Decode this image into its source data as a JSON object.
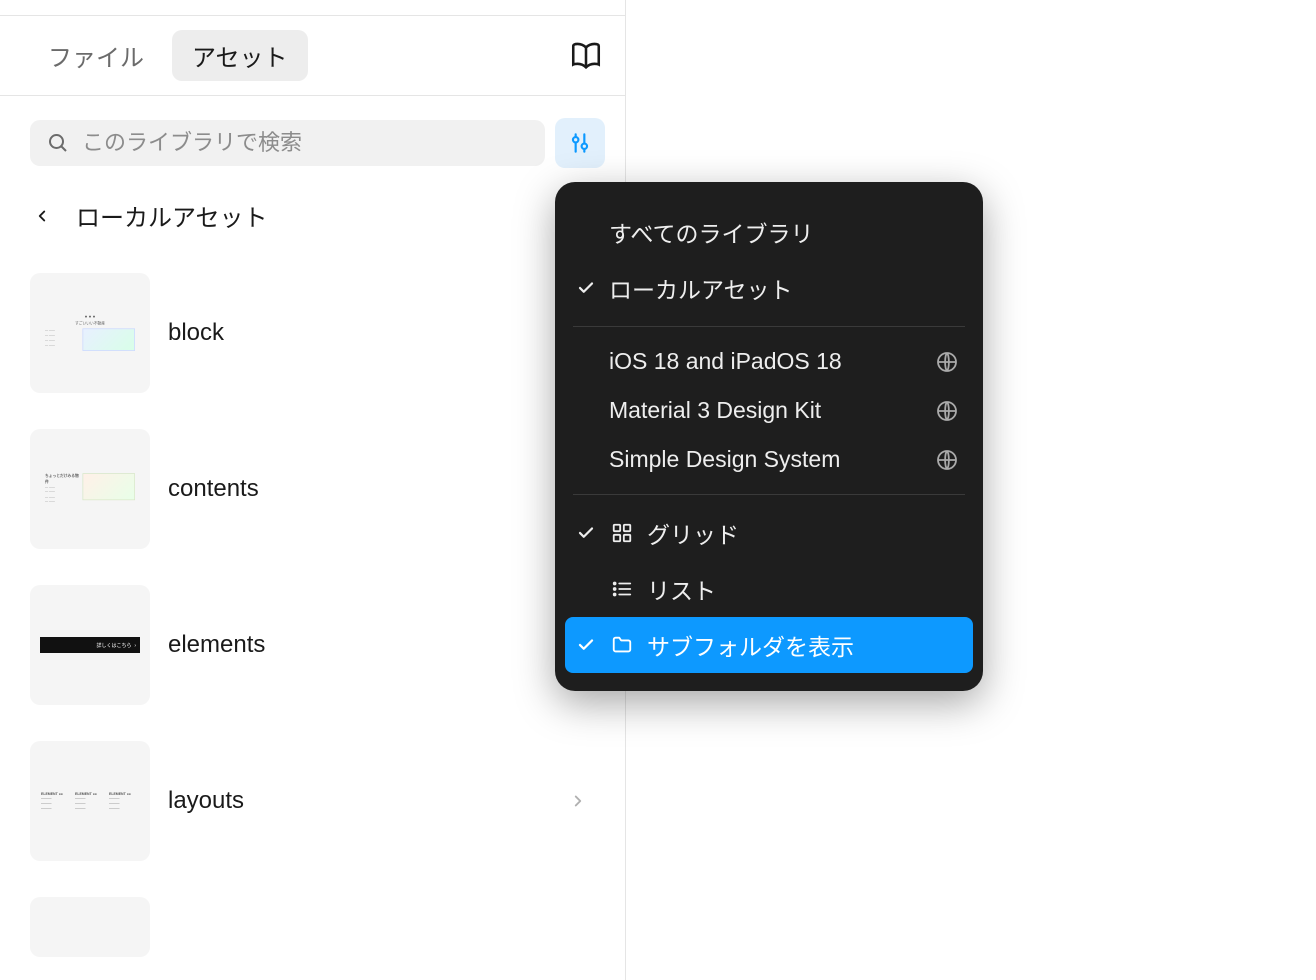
{
  "tabs": {
    "file": "ファイル",
    "assets": "アセット"
  },
  "search": {
    "placeholder": "このライブラリで検索"
  },
  "breadcrumb": {
    "label": "ローカルアセット"
  },
  "assets": [
    {
      "name": "block"
    },
    {
      "name": "contents"
    },
    {
      "name": "elements"
    },
    {
      "name": "layouts",
      "has_chevron": true
    }
  ],
  "popover": {
    "section1": [
      {
        "label": "すべてのライブラリ",
        "checked": false
      },
      {
        "label": "ローカルアセット",
        "checked": true
      }
    ],
    "section2": [
      {
        "label": "iOS 18 and iPadOS 18",
        "globe": true
      },
      {
        "label": "Material 3 Design Kit",
        "globe": true
      },
      {
        "label": "Simple Design System",
        "globe": true
      }
    ],
    "section3": [
      {
        "label": "グリッド",
        "icon": "grid",
        "checked": true
      },
      {
        "label": "リスト",
        "icon": "list",
        "checked": false
      },
      {
        "label": "サブフォルダを表示",
        "icon": "folder",
        "checked": true,
        "highlight": true
      }
    ]
  }
}
